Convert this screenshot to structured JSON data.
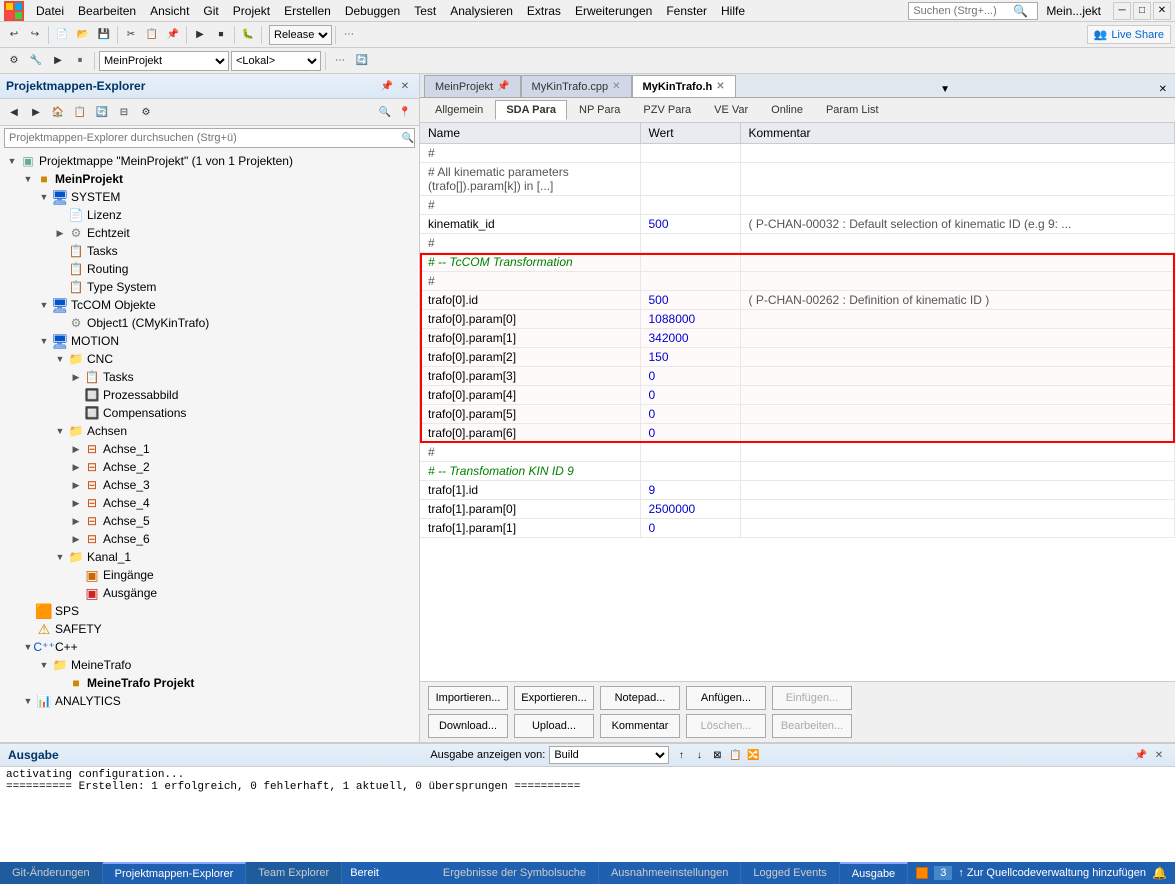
{
  "menubar": {
    "items": [
      "Datei",
      "Bearbeiten",
      "Ansicht",
      "Git",
      "Projekt",
      "Erstellen",
      "Debuggen",
      "Test",
      "Analysieren",
      "Extras",
      "Erweiterungen",
      "Fenster",
      "Hilfe"
    ],
    "search_placeholder": "Suchen (Strg+...)",
    "user": "Mein...jekt"
  },
  "toolbar": {
    "release_label": "Release",
    "liveshare_label": "Live Share",
    "project_label": "MeinProjekt",
    "platform_label": "<Lokal>"
  },
  "sidebar": {
    "title": "Projektmappen-Explorer",
    "search_placeholder": "Projektmappen-Explorer durchsuchen (Strg+ü)",
    "tree": [
      {
        "level": 0,
        "label": "Projektmappe \"MeinProjekt\" (1 von 1 Projekten)",
        "icon": "solution",
        "expanded": true
      },
      {
        "level": 1,
        "label": "MeinProjekt",
        "icon": "project",
        "expanded": true,
        "bold": true
      },
      {
        "level": 2,
        "label": "SYSTEM",
        "icon": "folder",
        "expanded": true
      },
      {
        "level": 3,
        "label": "Lizenz",
        "icon": "doc"
      },
      {
        "level": 3,
        "label": "Echtzeit",
        "icon": "folder",
        "expanded": false
      },
      {
        "level": 3,
        "label": "Tasks",
        "icon": "gear"
      },
      {
        "level": 3,
        "label": "Routing",
        "icon": "gear"
      },
      {
        "level": 3,
        "label": "Type System",
        "icon": "gear"
      },
      {
        "level": 2,
        "label": "TcCOM Objekte",
        "icon": "folder",
        "expanded": true
      },
      {
        "level": 3,
        "label": "Object1 (CMyKinTrafo)",
        "icon": "gear"
      },
      {
        "level": 2,
        "label": "MOTION",
        "icon": "folder",
        "expanded": true
      },
      {
        "level": 3,
        "label": "CNC",
        "icon": "folder",
        "expanded": true
      },
      {
        "level": 4,
        "label": "Tasks",
        "icon": "gear",
        "expanded": false
      },
      {
        "level": 4,
        "label": "Prozessabbild",
        "icon": "gear"
      },
      {
        "level": 4,
        "label": "Compensations",
        "icon": "gear"
      },
      {
        "level": 3,
        "label": "Achsen",
        "icon": "folder",
        "expanded": true
      },
      {
        "level": 4,
        "label": "Achse_1",
        "icon": "axis"
      },
      {
        "level": 4,
        "label": "Achse_2",
        "icon": "axis"
      },
      {
        "level": 4,
        "label": "Achse_3",
        "icon": "axis"
      },
      {
        "level": 4,
        "label": "Achse_4",
        "icon": "axis"
      },
      {
        "level": 4,
        "label": "Achse_5",
        "icon": "axis"
      },
      {
        "level": 4,
        "label": "Achse_6",
        "icon": "axis"
      },
      {
        "level": 3,
        "label": "Kanal_1",
        "icon": "folder",
        "expanded": true
      },
      {
        "level": 4,
        "label": "Eingänge",
        "icon": "io-in"
      },
      {
        "level": 4,
        "label": "Ausgänge",
        "icon": "io-out"
      },
      {
        "level": 1,
        "label": "SPS",
        "icon": "sps"
      },
      {
        "level": 1,
        "label": "SAFETY",
        "icon": "safety"
      },
      {
        "level": 1,
        "label": "C++",
        "icon": "cpp",
        "expanded": true
      },
      {
        "level": 2,
        "label": "MeineTrafo",
        "icon": "folder",
        "expanded": true
      },
      {
        "level": 3,
        "label": "MeineTrafo Projekt",
        "icon": "project",
        "bold": true
      },
      {
        "level": 1,
        "label": "ANALYTICS",
        "icon": "analytics"
      },
      {
        "level": 1,
        "label": "...",
        "icon": "more"
      }
    ]
  },
  "tabs": {
    "items": [
      {
        "label": "MeinProjekt",
        "active": false,
        "pinned": true
      },
      {
        "label": "MyKinTrafo.cpp",
        "active": false
      },
      {
        "label": "MyKinTrafo.h",
        "active": true
      }
    ]
  },
  "subtabs": {
    "items": [
      "Allgemein",
      "SDA Para",
      "NP Para",
      "PZV Para",
      "VE Var",
      "Online",
      "Param List"
    ],
    "active": "SDA Para"
  },
  "param_table": {
    "headers": [
      "Name",
      "Wert",
      "Kommentar"
    ],
    "rows": [
      {
        "name": "#",
        "value": "",
        "comment": "",
        "type": "hash"
      },
      {
        "name": "# All kinematic parameters (trafo[]).param[k]) in [...]",
        "value": "",
        "comment": "",
        "type": "comment"
      },
      {
        "name": "#",
        "value": "",
        "comment": "",
        "type": "hash"
      },
      {
        "name": "kinematik_id",
        "value": "500",
        "comment": "( P-CHAN-00032 : Default selection of kinematic ID (e.g 9: ...",
        "type": "param"
      },
      {
        "name": "#",
        "value": "",
        "comment": "",
        "type": "hash"
      },
      {
        "name": "# -- TcCOM Transformation",
        "value": "",
        "comment": "",
        "type": "section",
        "highlight_start": true
      },
      {
        "name": "#",
        "value": "",
        "comment": "",
        "type": "hash"
      },
      {
        "name": "trafo[0].id",
        "value": "500",
        "comment": "( P-CHAN-00262 : Definition of kinematic ID )",
        "type": "param"
      },
      {
        "name": "trafo[0].param[0]",
        "value": "1088000",
        "comment": "",
        "type": "param"
      },
      {
        "name": "trafo[0].param[1]",
        "value": "342000",
        "comment": "",
        "type": "param"
      },
      {
        "name": "trafo[0].param[2]",
        "value": "150",
        "comment": "",
        "type": "param"
      },
      {
        "name": "trafo[0].param[3]",
        "value": "0",
        "comment": "",
        "type": "param"
      },
      {
        "name": "trafo[0].param[4]",
        "value": "0",
        "comment": "",
        "type": "param"
      },
      {
        "name": "trafo[0].param[5]",
        "value": "0",
        "comment": "",
        "type": "param"
      },
      {
        "name": "trafo[0].param[6]",
        "value": "0",
        "comment": "",
        "type": "param",
        "highlight_end": true
      },
      {
        "name": "#",
        "value": "",
        "comment": "",
        "type": "hash"
      },
      {
        "name": "# -- Transfomation KIN ID 9",
        "value": "",
        "comment": "",
        "type": "section"
      },
      {
        "name": "trafo[1].id",
        "value": "9",
        "comment": "",
        "type": "param"
      },
      {
        "name": "trafo[1].param[0]",
        "value": "2500000",
        "comment": "",
        "type": "param"
      },
      {
        "name": "trafo[1].param[1]",
        "value": "0",
        "comment": "",
        "type": "param"
      }
    ]
  },
  "action_buttons": {
    "row1": [
      "Importieren...",
      "Exportieren...",
      "Notepad...",
      "Anfügen...",
      "Einfügen..."
    ],
    "row2": [
      "Download...",
      "Upload...",
      "Kommentar",
      "Löschen...",
      "Bearbeiten..."
    ],
    "disabled": [
      "Einfügen...",
      "Löschen...",
      "Bearbeiten..."
    ]
  },
  "output": {
    "title": "Ausgabe",
    "label": "Ausgabe anzeigen von:",
    "source": "Build",
    "lines": [
      "activating configuration...",
      "========== Erstellen: 1 erfolgreich, 0 fehlerhaft, 1 aktuell, 0 übersprungen =========="
    ]
  },
  "bottom_tabs": {
    "items": [
      "Git-Änderungen",
      "Projektmappen-Explorer",
      "Team Explorer"
    ],
    "active": "Projektmappen-Explorer"
  },
  "output_tabs": {
    "items": [
      "Ergebnisse der Symbolsuche",
      "Ausnahmeeinstellungen",
      "Logged Events",
      "Ausgabe"
    ],
    "active": "Ausgabe"
  },
  "statusbar": {
    "left": "Bereit",
    "right": "↑ Zur Quellcodeverwaltung hinzufügen",
    "num": "3"
  }
}
